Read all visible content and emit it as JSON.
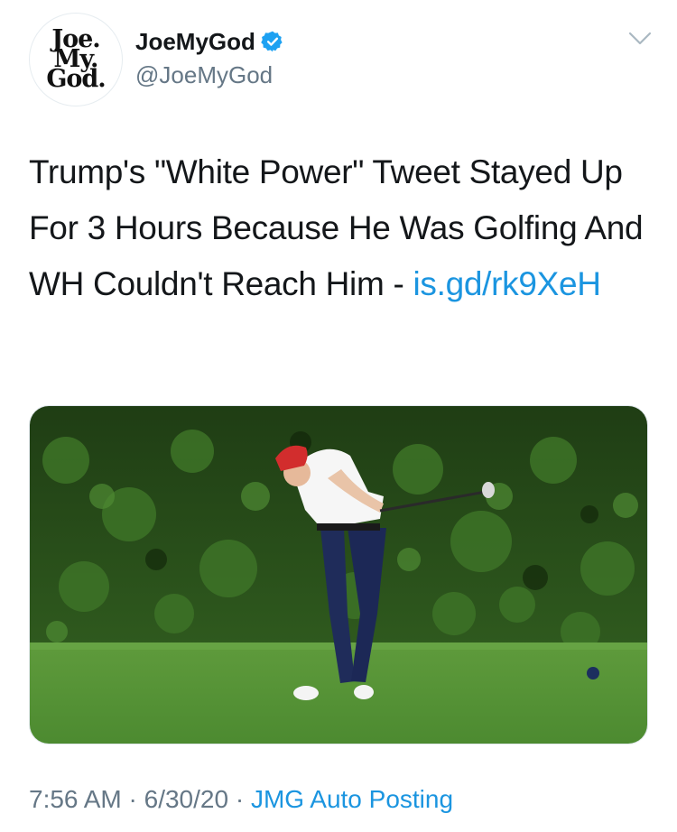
{
  "author": {
    "avatar_lines": [
      "Joe.",
      "My.",
      "God."
    ],
    "display_name": "JoeMyGod",
    "handle": "@JoeMyGod",
    "verified": true
  },
  "tweet": {
    "text": "Trump's \"White Power\" Tweet Stayed Up For 3 Hours Because He Was Golfing And WH Couldn't Reach Him - ",
    "link": "is.gd/rk9XeH",
    "media_icon": "photo-golfer-swing"
  },
  "meta": {
    "time": "7:56 AM",
    "date": "6/30/20",
    "separator": "·",
    "source": "JMG Auto Posting"
  },
  "colors": {
    "link": "#1b95e0",
    "secondary": "#657786",
    "verified": "#1da1f2"
  }
}
